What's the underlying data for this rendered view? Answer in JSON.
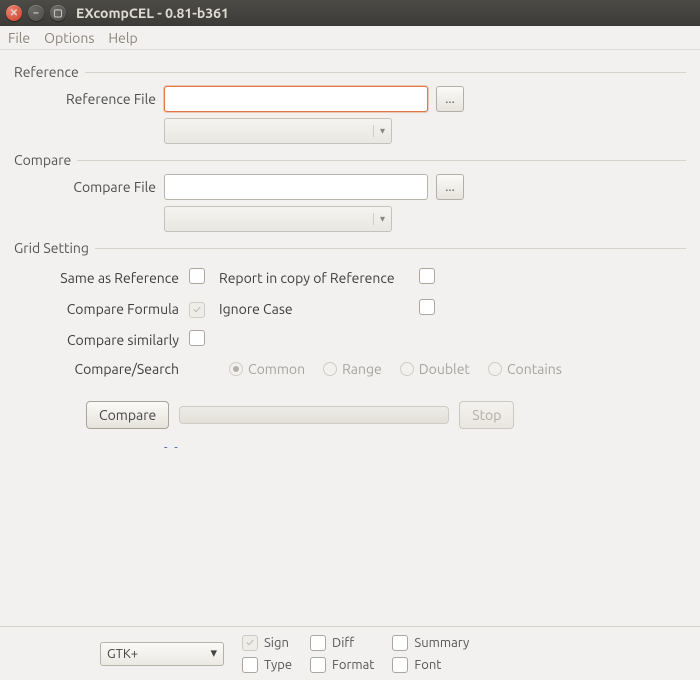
{
  "window": {
    "title": "EXcompCEL - 0.81-b361",
    "close_icon": "✕",
    "min_icon": "–",
    "max_icon": "▢"
  },
  "menu": {
    "file": "File",
    "options": "Options",
    "help": "Help"
  },
  "reference": {
    "group_label": "Reference",
    "file_label": "Reference File",
    "file_value": "",
    "browse_icon": "...",
    "sheet_value": ""
  },
  "compare": {
    "group_label": "Compare",
    "file_label": "Compare File",
    "file_value": "",
    "browse_icon": "...",
    "sheet_value": ""
  },
  "grid": {
    "group_label": "Grid Setting",
    "same_as_ref": "Same as Reference",
    "report_copy": "Report in copy of Reference",
    "compare_formula": "Compare Formula",
    "ignore_case": "Ignore Case",
    "compare_similarly": "Compare similarly",
    "compare_search": "Compare/Search",
    "radio_common": "Common",
    "radio_range": "Range",
    "radio_doublet": "Doublet",
    "radio_contains": "Contains",
    "check_mark": "✓"
  },
  "actions": {
    "compare": "Compare",
    "stop": "Stop",
    "links": "- -"
  },
  "bottom": {
    "theme": "GTK+",
    "arrow": "▾",
    "sign": "Sign",
    "diff": "Diff",
    "summary": "Summary",
    "type": "Type",
    "format": "Format",
    "font": "Font"
  }
}
